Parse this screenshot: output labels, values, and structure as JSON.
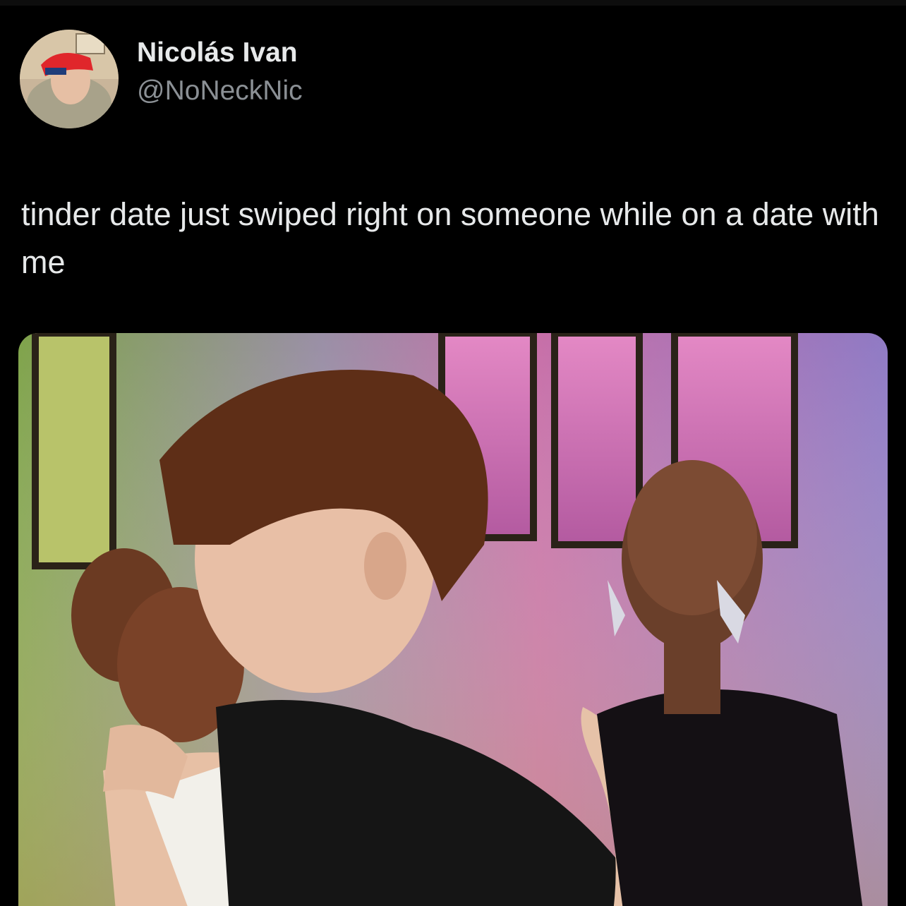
{
  "author": {
    "display_name": "Nicolás Ivan",
    "handle": "@NoNeckNic",
    "avatar_icon": "profile-photo"
  },
  "post": {
    "text": "tinder date just swiped right on someone while on a date with me"
  },
  "media": {
    "type": "photo",
    "description_icon": "photo-image"
  },
  "colors": {
    "background": "#000000",
    "text_primary": "#e7e9ea",
    "text_secondary": "#8b9095"
  }
}
